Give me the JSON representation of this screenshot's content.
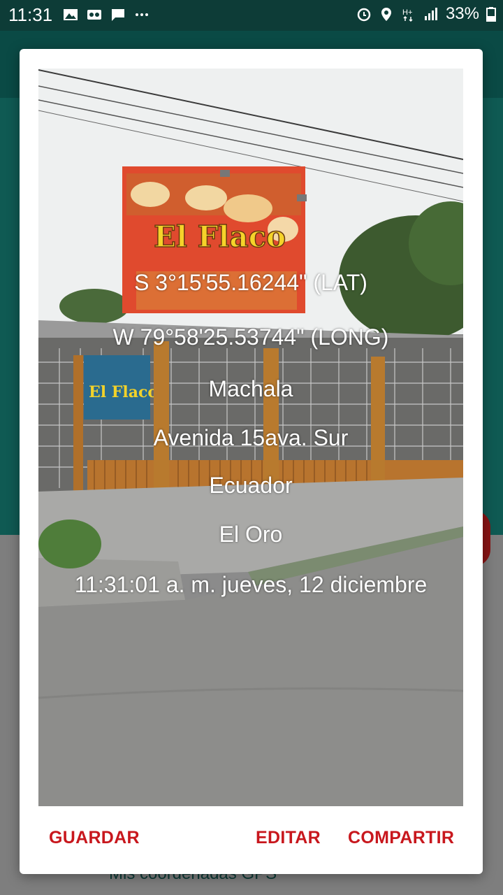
{
  "status_bar": {
    "time": "11:31",
    "battery": "33%",
    "left_icons": [
      "image-icon",
      "voicemail-icon",
      "message-icon",
      "more-dots-icon"
    ],
    "right_icons": [
      "alarm-icon",
      "location-icon",
      "network-hplus-icon",
      "signal-icon",
      "battery-icon"
    ]
  },
  "background": {
    "label": "Mis coordenadas GPS"
  },
  "dialog": {
    "overlay_lines": [
      "S 3°15'55.16244\" (LAT)",
      "W 79°58'25.53744\" (LONG)",
      "Machala",
      "Avenida 15ava. Sur",
      "Ecuador",
      "El Oro",
      "11:31:01 a. m. jueves, 12 diciembre"
    ],
    "buttons": {
      "save": "GUARDAR",
      "edit": "EDITAR",
      "share": "COMPARTIR"
    }
  },
  "colors": {
    "status_bar": "#0d3c37",
    "app_teal": "#0f5a53",
    "accent_button": "#c8171d"
  }
}
